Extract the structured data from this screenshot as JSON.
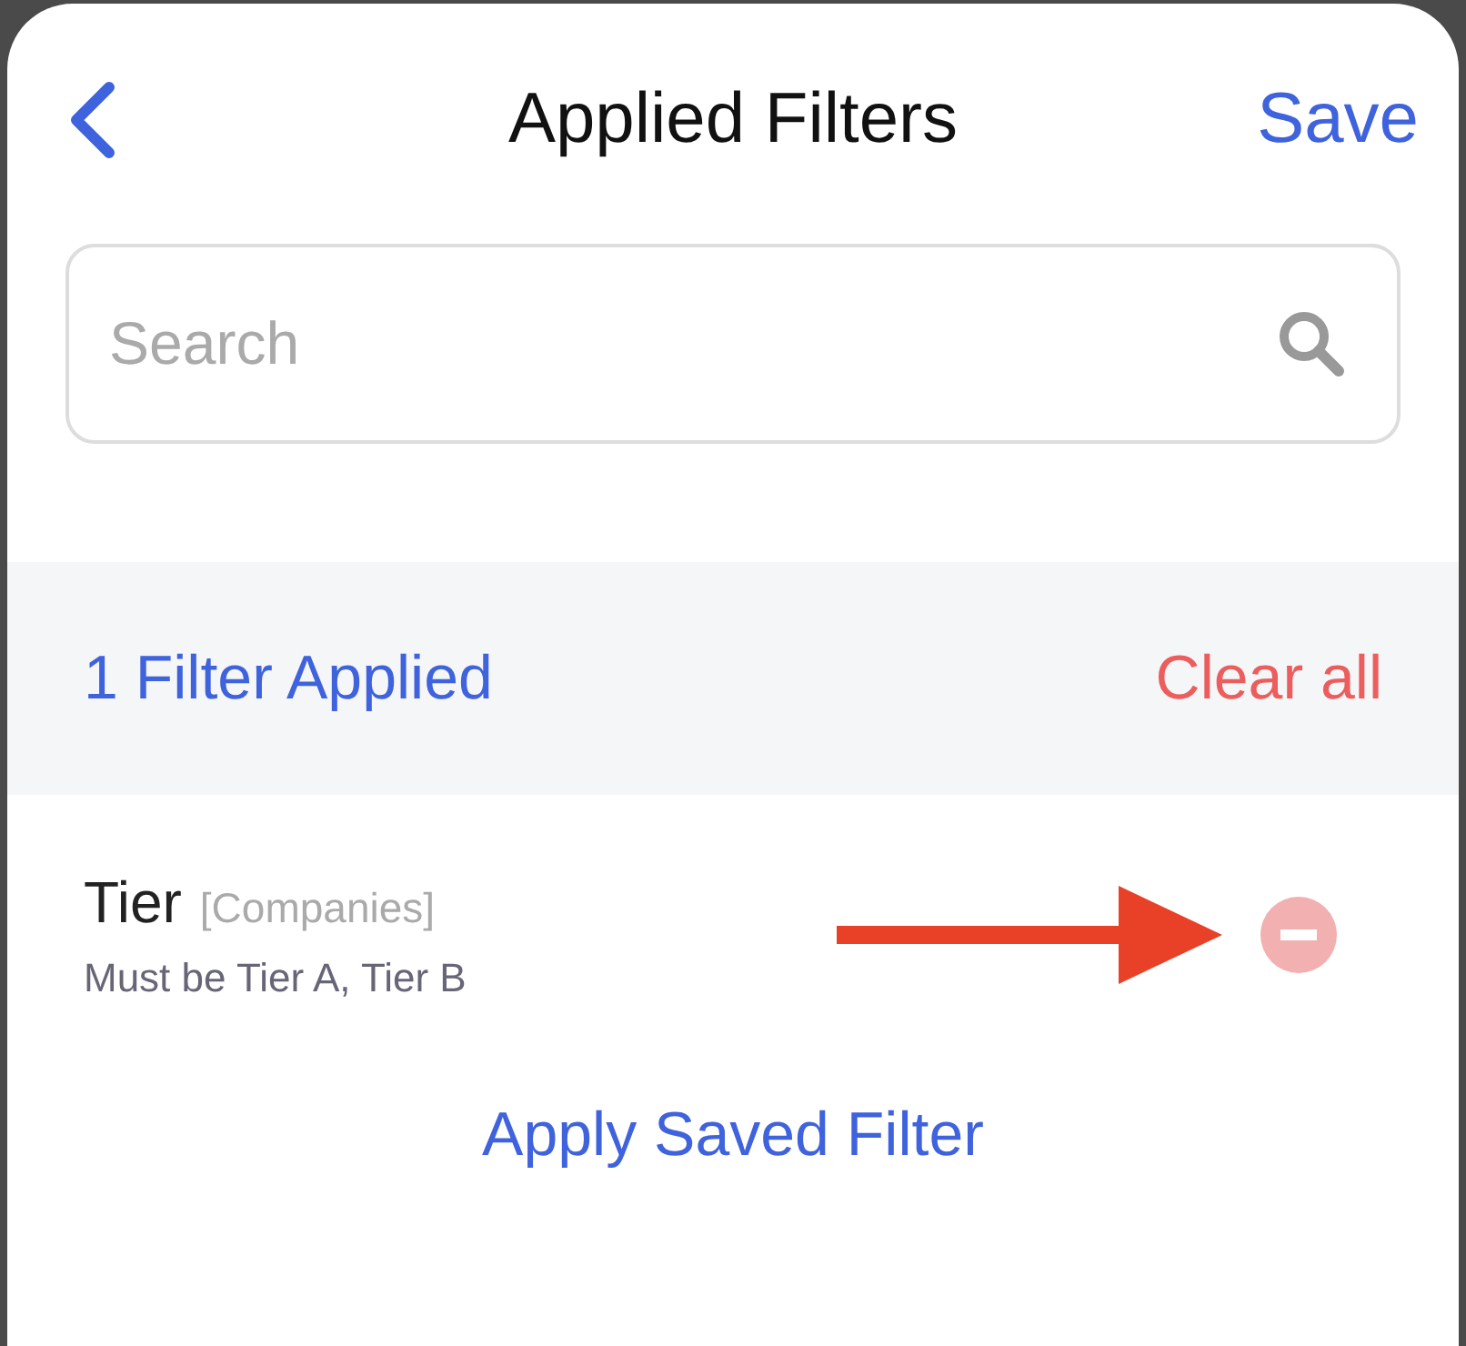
{
  "header": {
    "title": "Applied Filters",
    "action": "Save"
  },
  "search": {
    "placeholder": "Search"
  },
  "summary": {
    "count_label": "1 Filter Applied",
    "clear": "Clear all"
  },
  "filters": [
    {
      "name": "Tier",
      "scope": "[Companies]",
      "description": "Must be Tier A, Tier B"
    }
  ],
  "annotation": {
    "kind": "arrow"
  },
  "footer_link": "Apply Saved Filter"
}
